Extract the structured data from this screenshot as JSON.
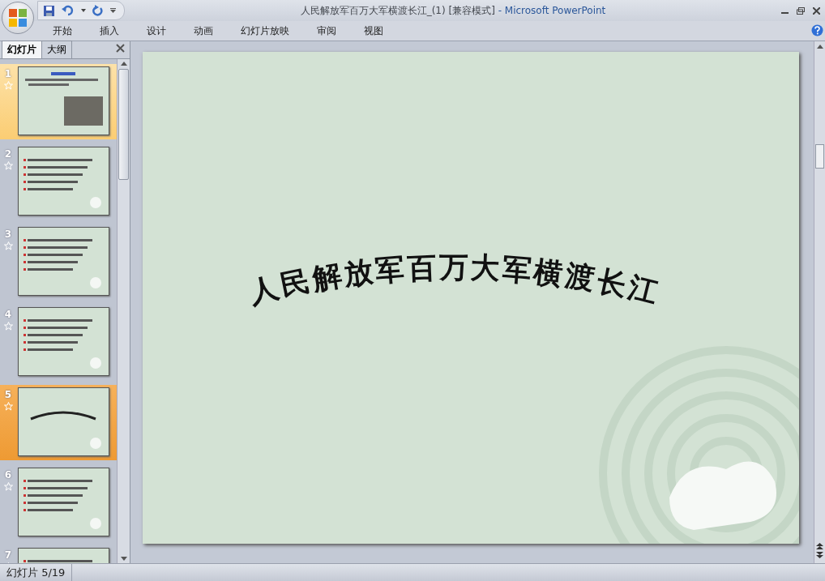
{
  "window": {
    "title": "人民解放军百万大军横渡长江_(1) [兼容模式]",
    "app_name": " - Microsoft PowerPoint"
  },
  "ribbon_tabs": [
    {
      "label": "开始",
      "selected": false
    },
    {
      "label": "插入",
      "selected": false
    },
    {
      "label": "设计",
      "selected": false
    },
    {
      "label": "动画",
      "selected": false
    },
    {
      "label": "幻灯片放映",
      "selected": false
    },
    {
      "label": "审阅",
      "selected": false
    },
    {
      "label": "视图",
      "selected": false
    }
  ],
  "pane_tabs": [
    {
      "label": "幻灯片",
      "selected": true
    },
    {
      "label": "大纲",
      "selected": false
    }
  ],
  "slides": [
    {
      "number": "1",
      "kind": "photo",
      "selected": false,
      "hover": true
    },
    {
      "number": "2",
      "kind": "list",
      "selected": false,
      "hover": false
    },
    {
      "number": "3",
      "kind": "list",
      "selected": false,
      "hover": false
    },
    {
      "number": "4",
      "kind": "list",
      "selected": false,
      "hover": false
    },
    {
      "number": "5",
      "kind": "title",
      "selected": true,
      "hover": false
    },
    {
      "number": "6",
      "kind": "list",
      "selected": false,
      "hover": false
    },
    {
      "number": "7",
      "kind": "list",
      "selected": false,
      "hover": false
    }
  ],
  "current_slide": {
    "title": "人民解放军百万大军横渡长江"
  },
  "status_bar": {
    "slide_position": "幻灯片 5/19"
  }
}
